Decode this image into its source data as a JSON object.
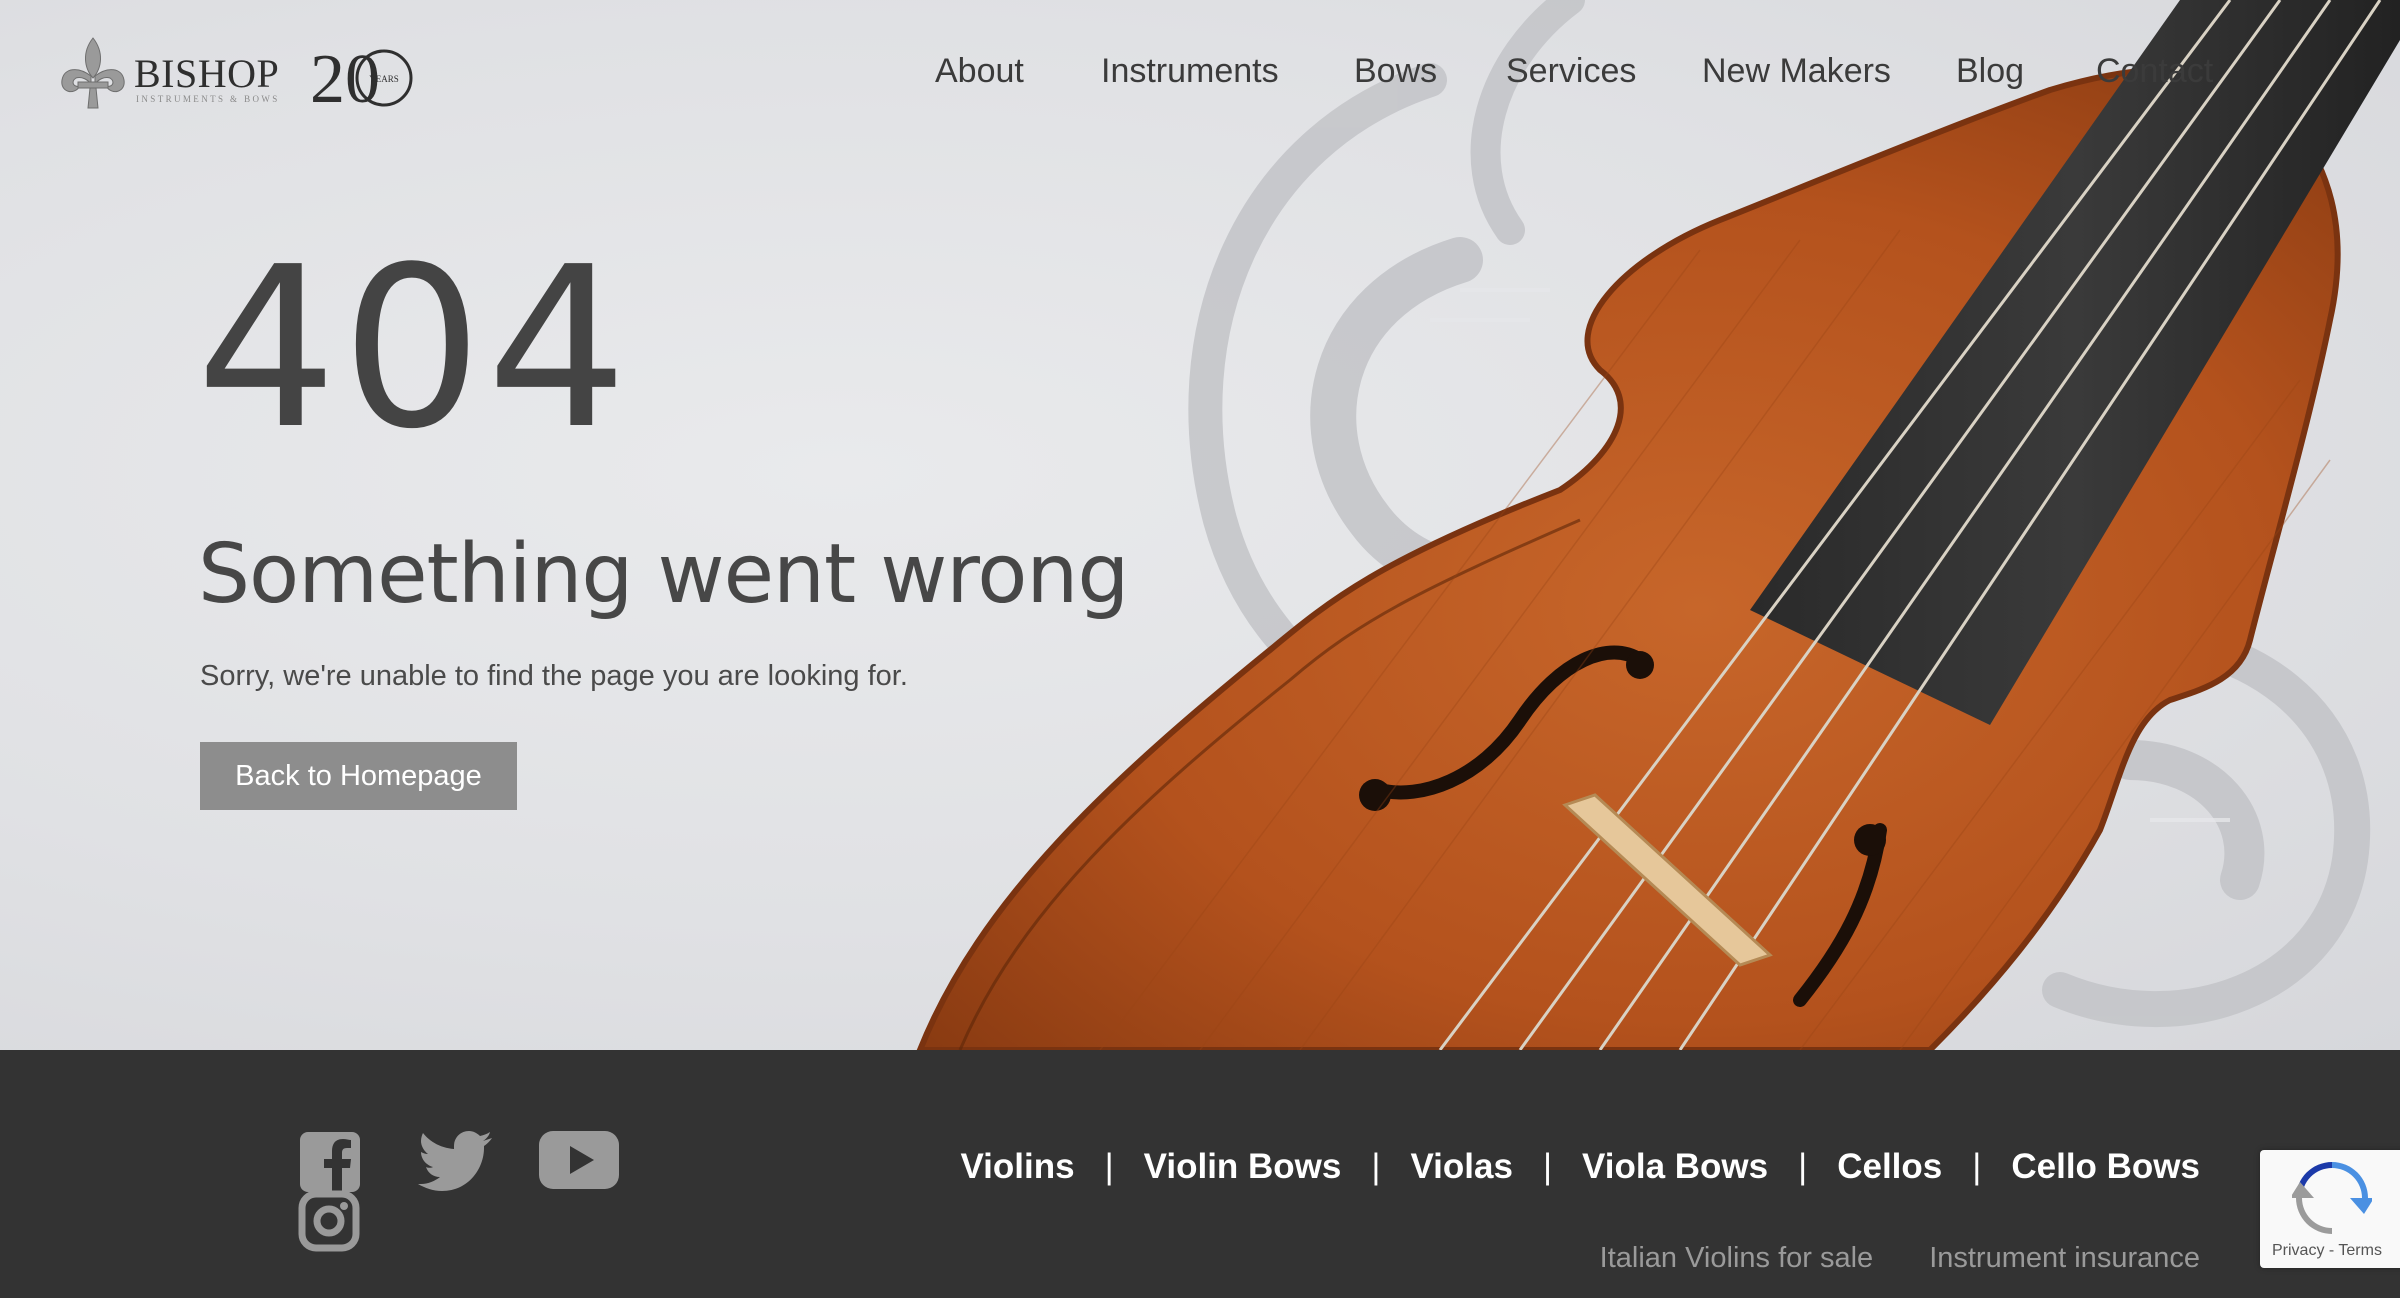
{
  "brand": {
    "name": "BISHOP",
    "tagline": "INSTRUMENTS & BOWS",
    "anniversary_number": "20",
    "anniversary_label": "YEARS"
  },
  "nav": {
    "items": [
      "About",
      "Instruments",
      "Bows",
      "Services",
      "New Makers",
      "Blog",
      "Contact"
    ]
  },
  "error": {
    "code": "404",
    "headline": "Something went wrong",
    "message": "Sorry, we're unable to find the page you are looking for.",
    "button_label": "Back to Homepage"
  },
  "footer": {
    "social": [
      "facebook-icon",
      "twitter-icon",
      "youtube-icon",
      "instagram-icon"
    ],
    "categories": [
      "Violins",
      "Violin Bows",
      "Violas",
      "Viola Bows",
      "Cellos",
      "Cello Bows"
    ],
    "links": [
      "Italian Violins for sale",
      "Instrument insurance"
    ]
  },
  "recaptcha": {
    "privacy": "Privacy",
    "separator": " - ",
    "terms": "Terms"
  },
  "colors": {
    "hero_bg": "#e3e4e7",
    "footer_bg": "#333333",
    "button_bg": "#8d8d8d",
    "text_dark": "#444444",
    "violin_wood": "#b8541f"
  }
}
